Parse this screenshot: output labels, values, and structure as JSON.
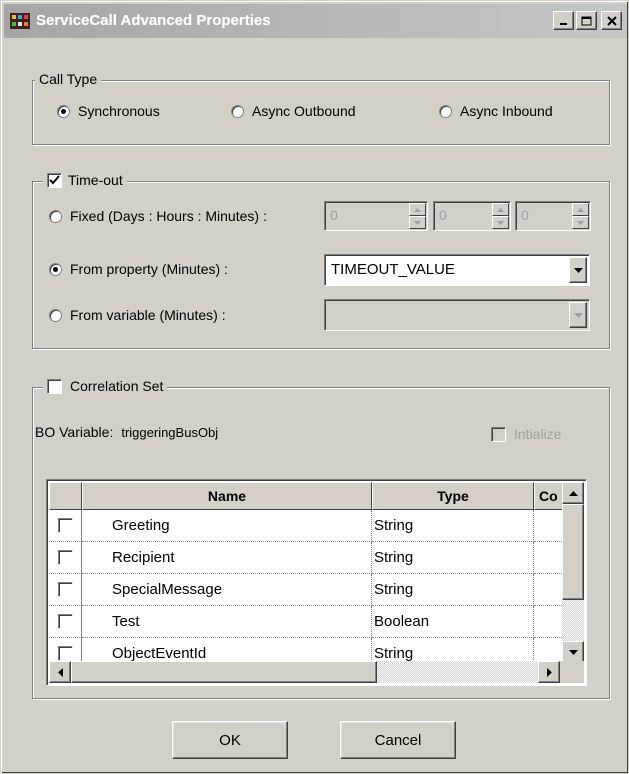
{
  "window": {
    "title": "ServiceCall Advanced Properties",
    "minimize_label": "_",
    "maximize_label": "□",
    "close_label": "×"
  },
  "call_type": {
    "legend": "Call Type",
    "options": [
      {
        "label": "Synchronous",
        "checked": true
      },
      {
        "label": "Async Outbound",
        "checked": false
      },
      {
        "label": "Async Inbound",
        "checked": false
      }
    ]
  },
  "timeout": {
    "legend": "Time-out",
    "checked": true,
    "fixed_label": "Fixed (Days : Hours : Minutes) :",
    "fixed_days": "0",
    "fixed_hours": "0",
    "fixed_minutes": "0",
    "property_label": "From property (Minutes) :",
    "property_value": "TIMEOUT_VALUE",
    "variable_label": "From variable (Minutes) :",
    "variable_value": "",
    "selected": "property"
  },
  "correlation": {
    "legend": "Correlation Set",
    "checked": false,
    "bo_label": "BO Variable:",
    "bo_value": "triggeringBusObj",
    "initialize_label": "Intialize",
    "columns": [
      "",
      "Name",
      "Type",
      "Co"
    ],
    "rows": [
      {
        "name": "Greeting",
        "type": "String"
      },
      {
        "name": "Recipient",
        "type": "String"
      },
      {
        "name": "SpecialMessage",
        "type": "String"
      },
      {
        "name": "Test",
        "type": "Boolean"
      },
      {
        "name": "ObjectEventId",
        "type": "String"
      }
    ]
  },
  "buttons": {
    "ok": "OK",
    "cancel": "Cancel"
  }
}
